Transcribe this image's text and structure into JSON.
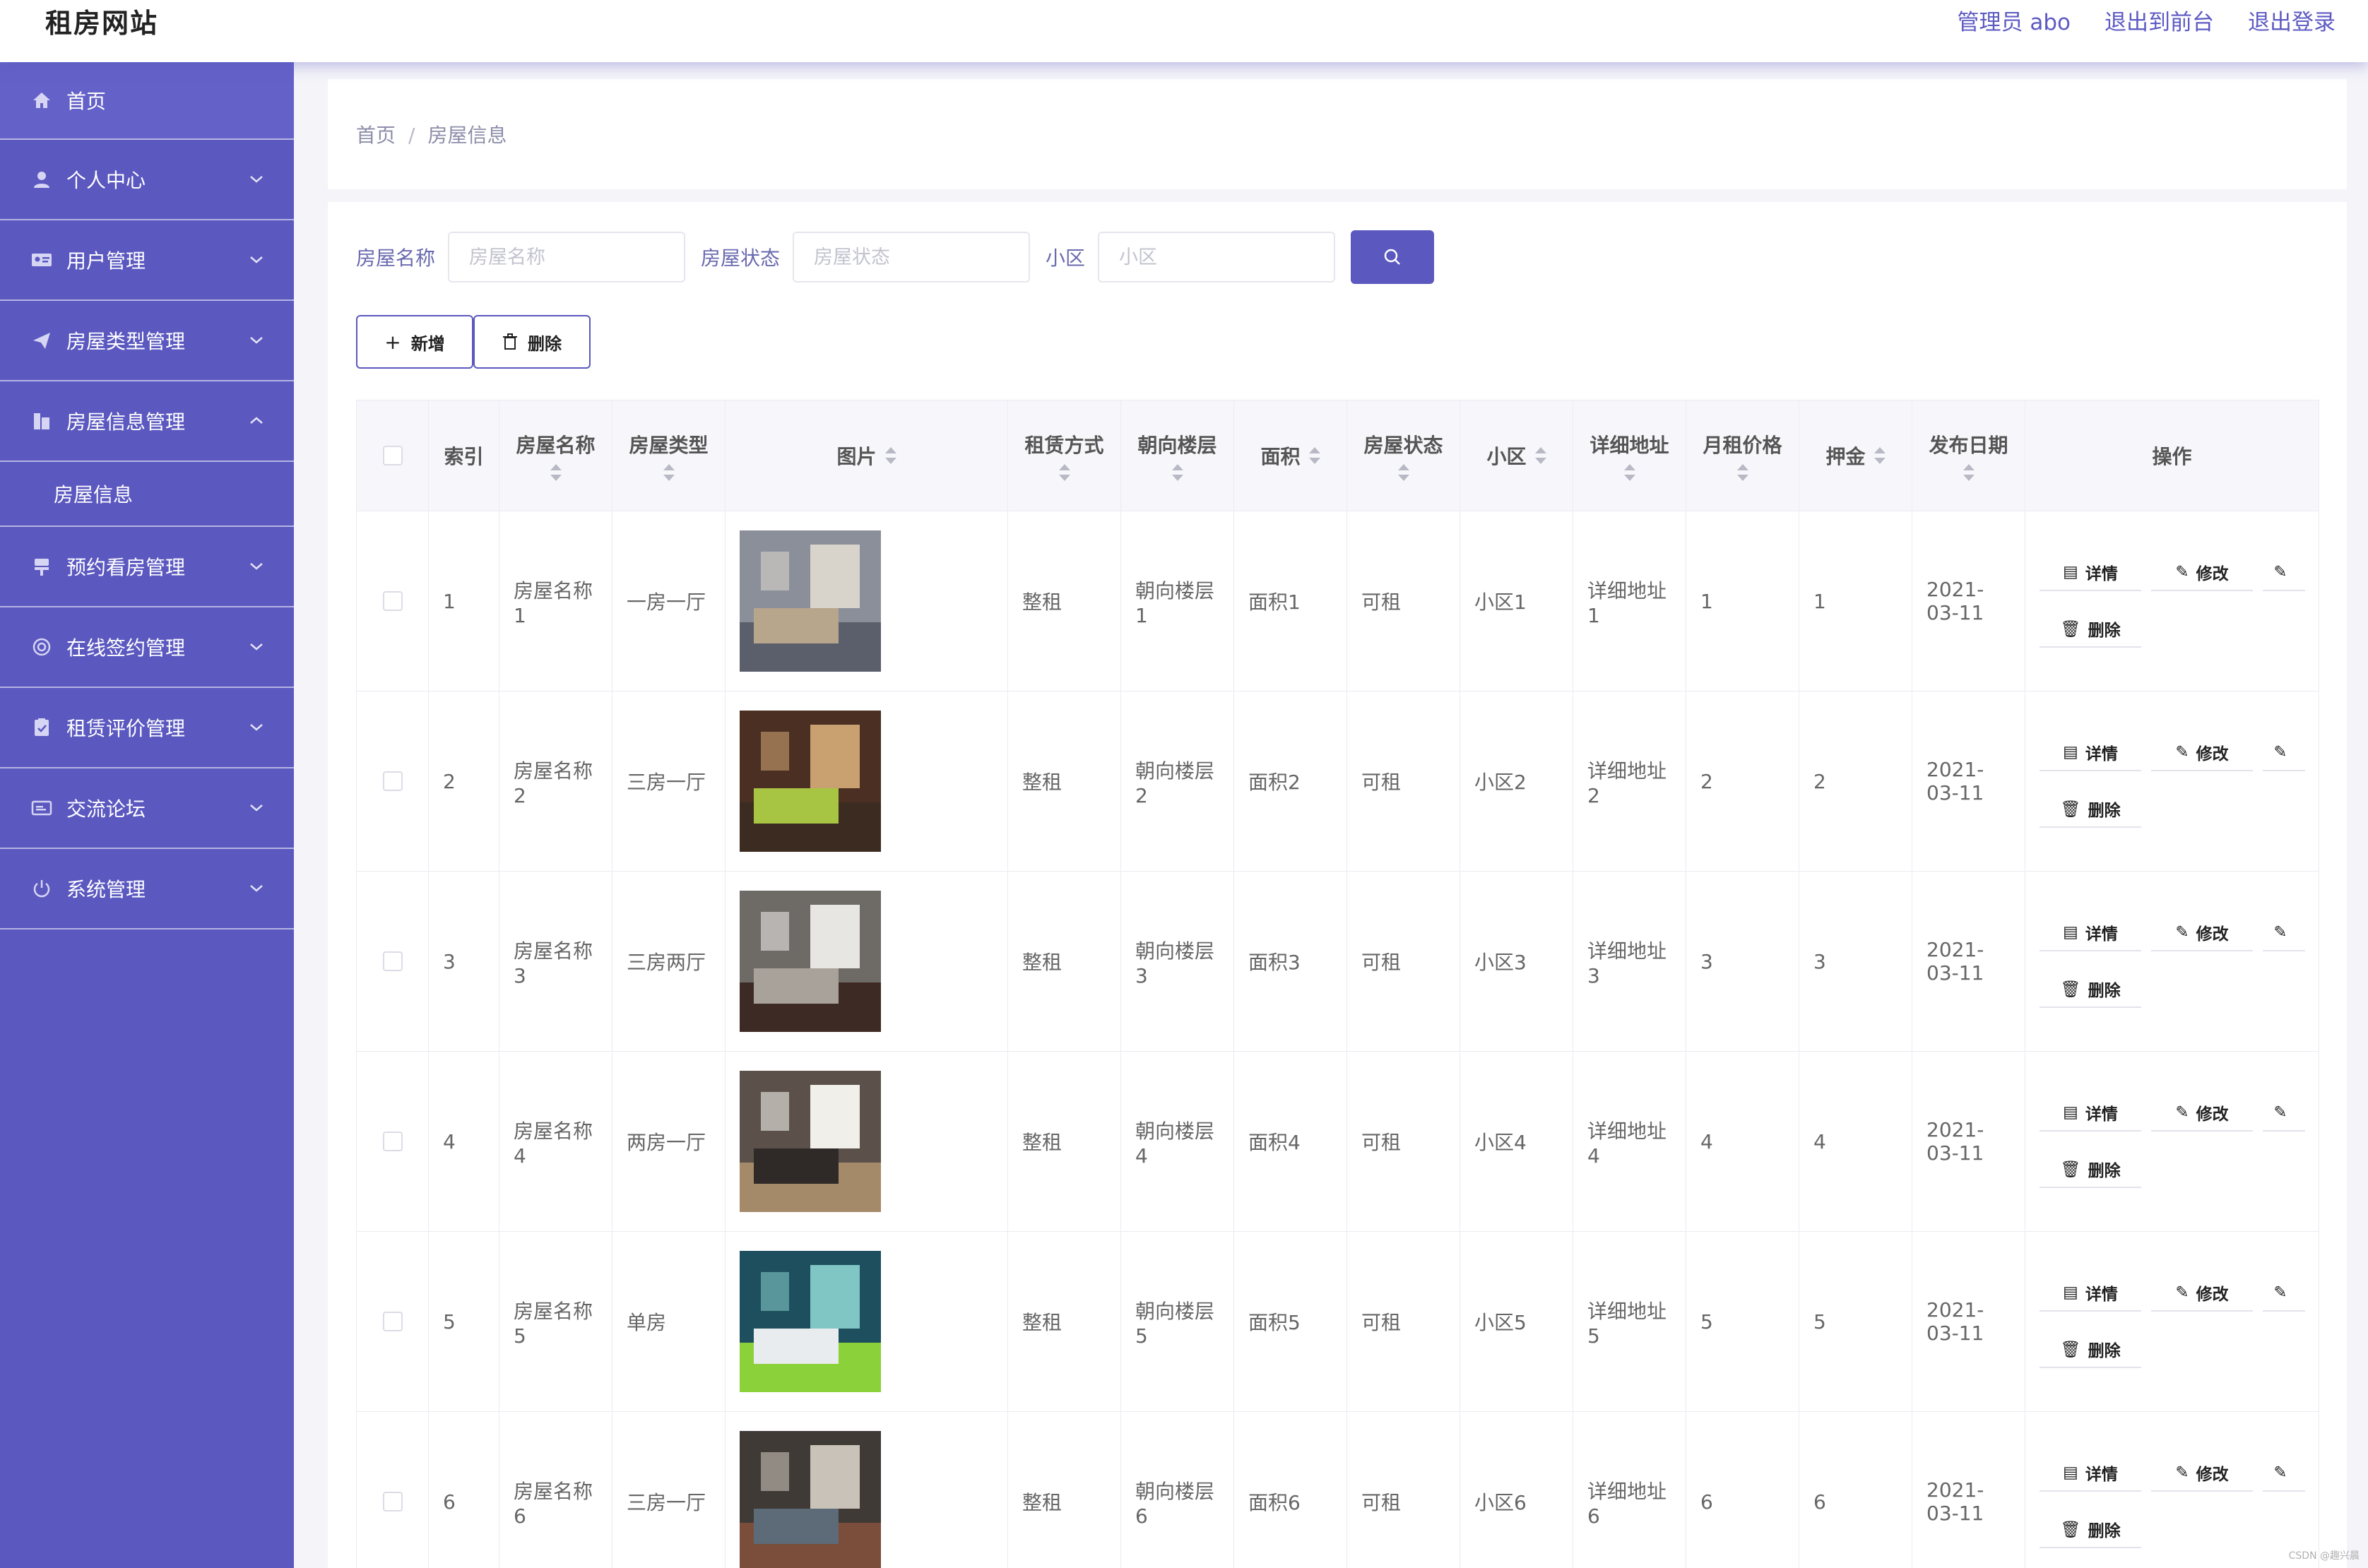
{
  "brand": "租房网站",
  "top_links": [
    "管理员 abo",
    "退出到前台",
    "退出登录"
  ],
  "sidebar": {
    "items": [
      {
        "label": "首页",
        "icon": "home-icon"
      },
      {
        "label": "个人中心",
        "icon": "user-icon"
      },
      {
        "label": "用户管理",
        "icon": "id-card-icon"
      },
      {
        "label": "房屋类型管理",
        "icon": "send-icon"
      },
      {
        "label": "房屋信息管理",
        "icon": "building-icon",
        "expanded": true
      },
      {
        "label": "预约看房管理",
        "icon": "pin-icon"
      },
      {
        "label": "在线签约管理",
        "icon": "seal-icon"
      },
      {
        "label": "租赁评价管理",
        "icon": "clipboard-icon"
      },
      {
        "label": "交流论坛",
        "icon": "message-icon"
      },
      {
        "label": "系统管理",
        "icon": "power-icon"
      }
    ],
    "submenu": {
      "label": "房屋信息"
    }
  },
  "breadcrumb": {
    "home": "首页",
    "separator": "/",
    "current": "房屋信息"
  },
  "search": {
    "fields": [
      {
        "label": "房屋名称",
        "placeholder": "房屋名称"
      },
      {
        "label": "房屋状态",
        "placeholder": "房屋状态"
      },
      {
        "label": "小区",
        "placeholder": "小区"
      }
    ]
  },
  "toolbar": {
    "add_label": "新增",
    "delete_label": "删除"
  },
  "table": {
    "headers": [
      "索引",
      "房屋名称",
      "房屋类型",
      "图片",
      "租赁方式",
      "朝向楼层",
      "面积",
      "房屋状态",
      "小区",
      "详细地址",
      "月租价格",
      "押金",
      "发布日期",
      "操作"
    ],
    "actions": {
      "detail": "详情",
      "edit": "修改",
      "delete": "删除"
    },
    "rows": [
      {
        "index": "1",
        "name": "房屋名称1",
        "type": "一房一厅",
        "mode": "整租",
        "floor": "朝向楼层1",
        "area": "面积1",
        "status": "可租",
        "community": "小区1",
        "address": "详细地址1",
        "price": "1",
        "deposit": "1",
        "date": "2021-03-11"
      },
      {
        "index": "2",
        "name": "房屋名称2",
        "type": "三房一厅",
        "mode": "整租",
        "floor": "朝向楼层2",
        "area": "面积2",
        "status": "可租",
        "community": "小区2",
        "address": "详细地址2",
        "price": "2",
        "deposit": "2",
        "date": "2021-03-11"
      },
      {
        "index": "3",
        "name": "房屋名称3",
        "type": "三房两厅",
        "mode": "整租",
        "floor": "朝向楼层3",
        "area": "面积3",
        "status": "可租",
        "community": "小区3",
        "address": "详细地址3",
        "price": "3",
        "deposit": "3",
        "date": "2021-03-11"
      },
      {
        "index": "4",
        "name": "房屋名称4",
        "type": "两房一厅",
        "mode": "整租",
        "floor": "朝向楼层4",
        "area": "面积4",
        "status": "可租",
        "community": "小区4",
        "address": "详细地址4",
        "price": "4",
        "deposit": "4",
        "date": "2021-03-11"
      },
      {
        "index": "5",
        "name": "房屋名称5",
        "type": "单房",
        "mode": "整租",
        "floor": "朝向楼层5",
        "area": "面积5",
        "status": "可租",
        "community": "小区5",
        "address": "详细地址5",
        "price": "5",
        "deposit": "5",
        "date": "2021-03-11"
      },
      {
        "index": "6",
        "name": "房屋名称6",
        "type": "三房一厅",
        "mode": "整租",
        "floor": "朝向楼层6",
        "area": "面积6",
        "status": "可租",
        "community": "小区6",
        "address": "详细地址6",
        "price": "6",
        "deposit": "6",
        "date": "2021-03-11"
      }
    ]
  },
  "colors": {
    "accent": "#5b58c0",
    "sidebar_bg": "#5b58c0",
    "page_bg": "#f4f4f9"
  },
  "watermark": "CSDN @趣兴晨"
}
